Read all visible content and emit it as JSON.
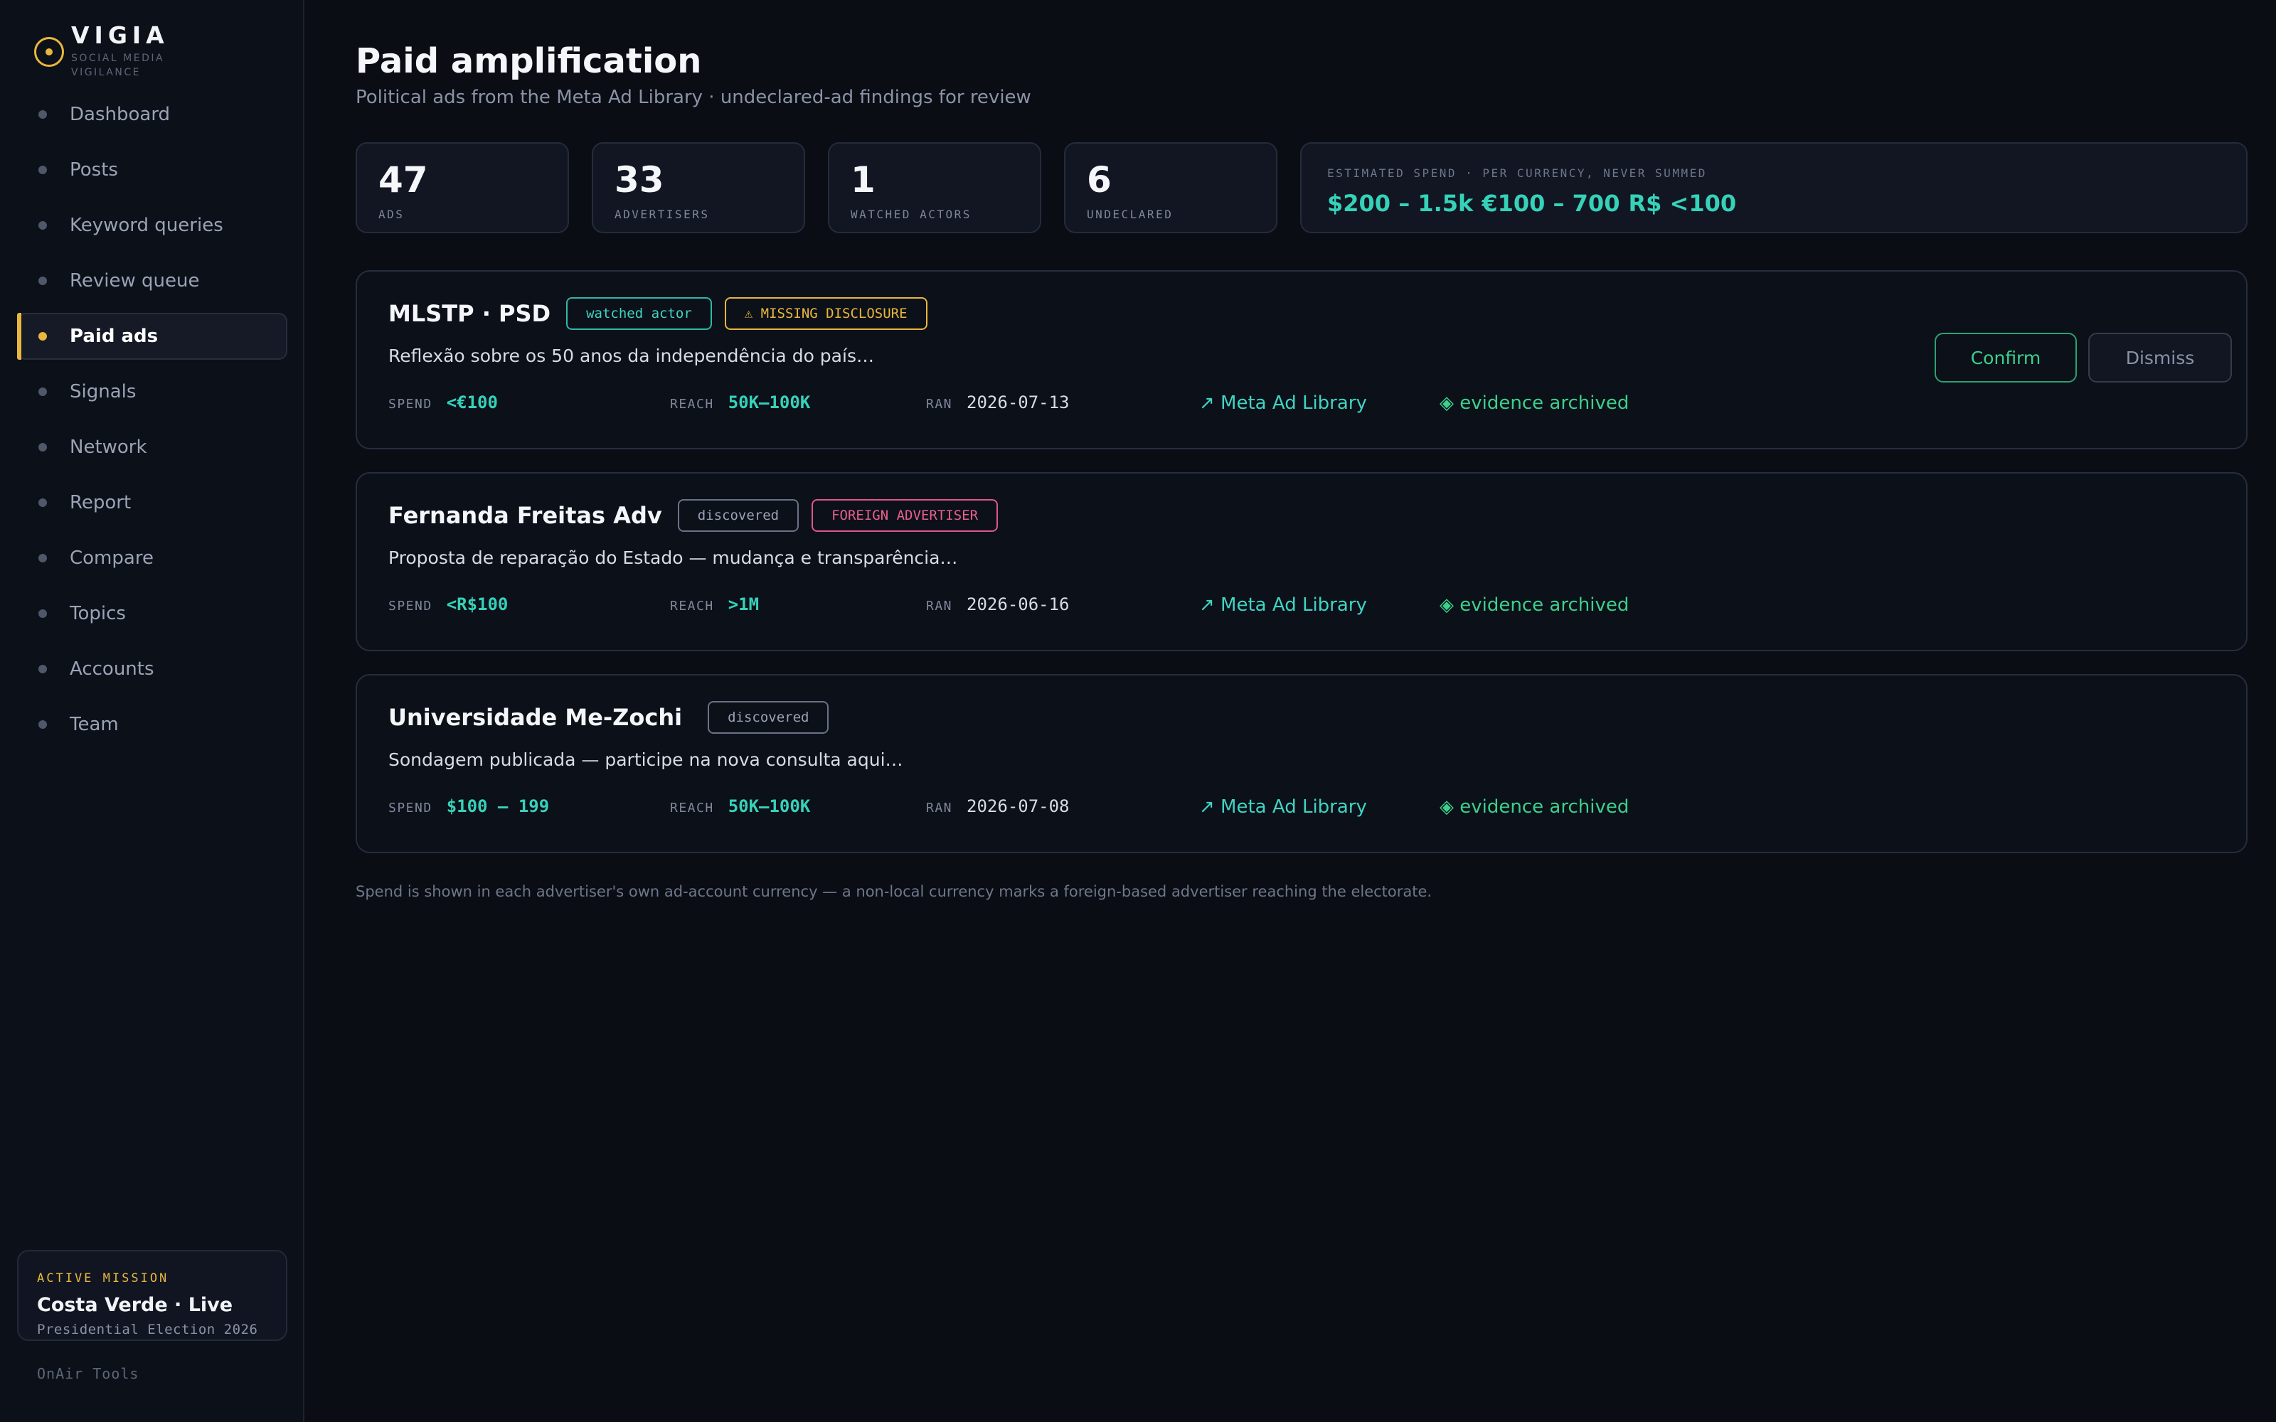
{
  "brand": {
    "name": "VIGIA",
    "subtitle": "SOCIAL MEDIA VIGILANCE",
    "accent": "#e8b73c"
  },
  "sidebar": {
    "items": [
      {
        "label": "Dashboard",
        "active": false
      },
      {
        "label": "Posts",
        "active": false
      },
      {
        "label": "Keyword queries",
        "active": false
      },
      {
        "label": "Review queue",
        "active": false
      },
      {
        "label": "Paid ads",
        "active": true
      },
      {
        "label": "Signals",
        "active": false
      },
      {
        "label": "Network",
        "active": false
      },
      {
        "label": "Report",
        "active": false
      },
      {
        "label": "Compare",
        "active": false
      },
      {
        "label": "Topics",
        "active": false
      },
      {
        "label": "Accounts",
        "active": false
      },
      {
        "label": "Team",
        "active": false
      }
    ],
    "mission": {
      "label": "ACTIVE MISSION",
      "title": "Costa Verde · Live",
      "subtitle": "Presidential Election 2026"
    },
    "footer": "OnAir Tools"
  },
  "page": {
    "title": "Paid amplification",
    "subtitle": "Political ads from the Meta Ad Library · undeclared-ad findings for review"
  },
  "stats": [
    {
      "value": "47",
      "label": "ADS"
    },
    {
      "value": "33",
      "label": "ADVERTISERS"
    },
    {
      "value": "1",
      "label": "WATCHED ACTORS"
    },
    {
      "value": "6",
      "label": "UNDECLARED"
    }
  ],
  "spend": {
    "label": "ESTIMATED SPEND · PER CURRENCY, NEVER SUMMED",
    "values": [
      "$200 – 1.5k",
      "€100 – 700",
      "R$ <100"
    ]
  },
  "ads": [
    {
      "advertiser": "MLSTP · PSD",
      "tags": [
        {
          "text": "watched actor",
          "kind": "watched"
        },
        {
          "text": "⚠ MISSING DISCLOSURE",
          "kind": "missing"
        }
      ],
      "text": "Reflexão sobre os 50 anos da independência do país…",
      "spend_label": "SPEND",
      "spend": "<€100",
      "reach_label": "REACH",
      "reach": "50K–100K",
      "ran_label": "RAN",
      "ran": "2026-07-13",
      "library_link": "↗ Meta Ad Library",
      "evidence": "◈ evidence archived",
      "actions": {
        "confirm": "Confirm",
        "dismiss": "Dismiss"
      }
    },
    {
      "advertiser": "Fernanda Freitas Adv",
      "tags": [
        {
          "text": "discovered",
          "kind": "discovered"
        },
        {
          "text": "FOREIGN ADVERTISER",
          "kind": "foreign"
        }
      ],
      "text": "Proposta de reparação do Estado — mudança e transparência…",
      "spend_label": "SPEND",
      "spend": "<R$100",
      "reach_label": "REACH",
      "reach": ">1M",
      "ran_label": "RAN",
      "ran": "2026-06-16",
      "library_link": "↗ Meta Ad Library",
      "evidence": "◈ evidence archived"
    },
    {
      "advertiser": "Universidade Me-Zochi",
      "tags": [
        {
          "text": "discovered",
          "kind": "discovered"
        }
      ],
      "text": "Sondagem publicada — participe na nova consulta aqui…",
      "spend_label": "SPEND",
      "spend": "$100 – 199",
      "reach_label": "REACH",
      "reach": "50K–100K",
      "ran_label": "RAN",
      "ran": "2026-07-08",
      "library_link": "↗ Meta Ad Library",
      "evidence": "◈ evidence archived"
    }
  ],
  "footnote": "Spend is shown in each advertiser's own ad-account currency — a non-local currency marks a foreign-based advertiser reaching the electorate."
}
